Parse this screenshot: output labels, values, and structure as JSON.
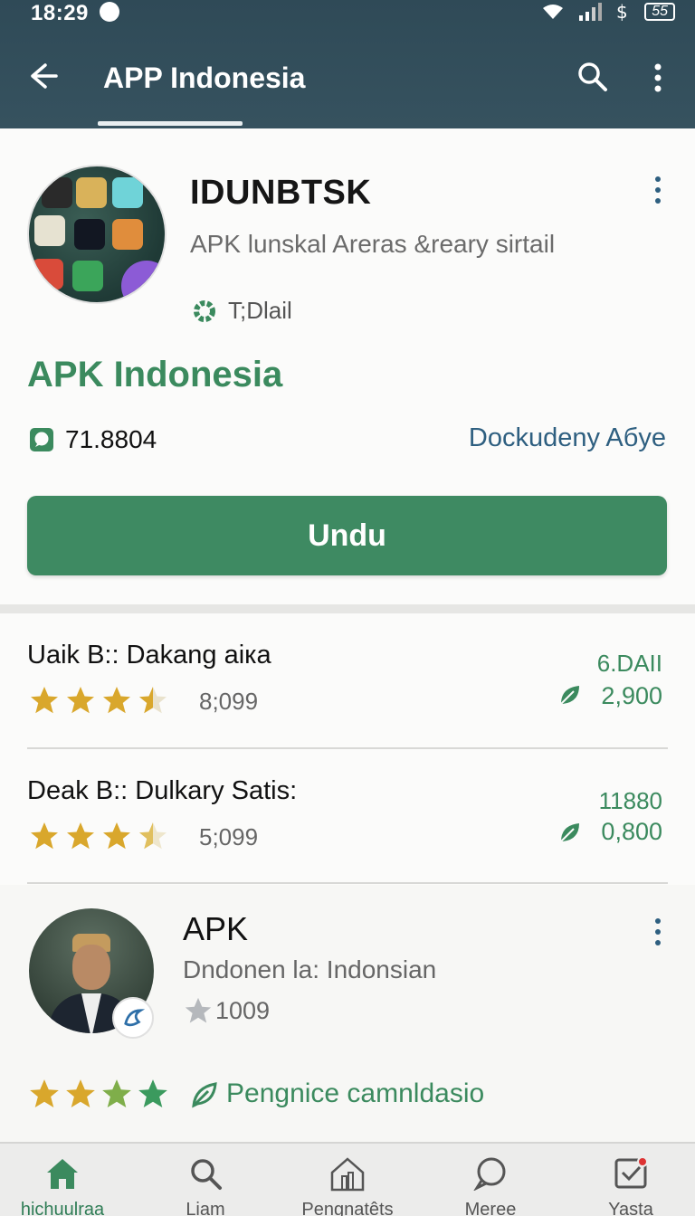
{
  "status_bar": {
    "time": "18:29",
    "battery": "55"
  },
  "app_bar": {
    "title": "APP Indonesia"
  },
  "app": {
    "name": "IDUNBTSK",
    "subtitle": "APK lunskal Areras &reary sirtail",
    "tag": "T;Dlail",
    "brand": "APK Indonesia",
    "downloads": "71.8804",
    "developer_link": "Dockudeny Aбye",
    "install_label": "Undu"
  },
  "reviews": [
    {
      "title": "Uaik B:: Dakang aiка",
      "stars": 3.5,
      "count": "8;099",
      "value_top": "6.DAII",
      "value_bottom": "2,900"
    },
    {
      "title": "Deak B:: Dulkary Satis:",
      "stars": 3.5,
      "count": "5;099",
      "value_top": "11880",
      "value_bottom": "0,800"
    }
  ],
  "publisher": {
    "name": "APK",
    "subtitle": "Dndonen la: Indonsian",
    "rating": "1009",
    "stars": 4,
    "recommendation": "Pengnice camnldasio"
  },
  "bottom_nav": [
    {
      "label": "hichuulraa",
      "icon": "home-icon",
      "active": true
    },
    {
      "label": "Liam",
      "icon": "search-icon",
      "active": false
    },
    {
      "label": "Pengnatêts",
      "icon": "apps-icon",
      "active": false
    },
    {
      "label": "Meree",
      "icon": "chat-icon",
      "active": false
    },
    {
      "label": "Yasta",
      "icon": "checkbox-icon",
      "active": false
    }
  ],
  "colors": {
    "app_bar": "#36525f",
    "accent": "#3e8a62",
    "link": "#2e5f80",
    "star": "#d9a72c"
  }
}
